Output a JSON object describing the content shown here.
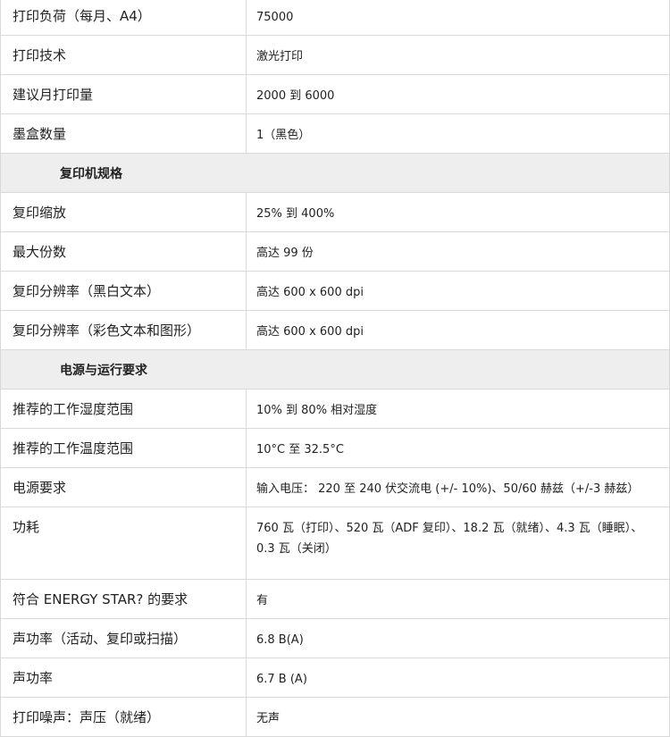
{
  "table": {
    "rows": [
      {
        "kind": "row",
        "label": "打印负荷（每月、A4）",
        "value": "75000"
      },
      {
        "kind": "row",
        "label": "打印技术",
        "value": "激光打印"
      },
      {
        "kind": "row",
        "label": "建议月打印量",
        "value": "2000 到 6000"
      },
      {
        "kind": "row",
        "label": "墨盒数量",
        "value": "1（黑色）"
      },
      {
        "kind": "section",
        "title": "复印机规格"
      },
      {
        "kind": "row",
        "label": "复印缩放",
        "value": "25% 到 400%"
      },
      {
        "kind": "row",
        "label": "最大份数",
        "value": "高达 99 份"
      },
      {
        "kind": "row",
        "label": "复印分辨率（黑白文本）",
        "value": "高达 600 x 600 dpi"
      },
      {
        "kind": "row",
        "label": "复印分辨率（彩色文本和图形）",
        "value": "高达 600 x 600 dpi"
      },
      {
        "kind": "section",
        "title": "电源与运行要求"
      },
      {
        "kind": "row",
        "label": "推荐的工作湿度范围",
        "value": "10% 到 80% 相对湿度"
      },
      {
        "kind": "row",
        "label": "推荐的工作温度范围",
        "value": "10°C 至 32.5°C"
      },
      {
        "kind": "row",
        "label": "电源要求",
        "value": "输入电压： 220 至 240 伏交流电 (+/- 10%)、50/60 赫兹（+/-3 赫兹）"
      },
      {
        "kind": "tall",
        "label": "功耗",
        "value_line1": "760 瓦（打印）、520 瓦（ADF 复印）、18.2 瓦（就绪）、4.3 瓦（睡眠）、",
        "value_line2": "0.3 瓦（关闭）"
      },
      {
        "kind": "row",
        "label": "符合 ENERGY STAR? 的要求",
        "value": "有"
      },
      {
        "kind": "row",
        "label": "声功率（活动、复印或扫描）",
        "value": "6.8 B(A)"
      },
      {
        "kind": "row",
        "label": "声功率",
        "value": "6.7 B (A)"
      },
      {
        "kind": "row",
        "label": "打印噪声：声压（就绪）",
        "value": "无声"
      }
    ]
  }
}
